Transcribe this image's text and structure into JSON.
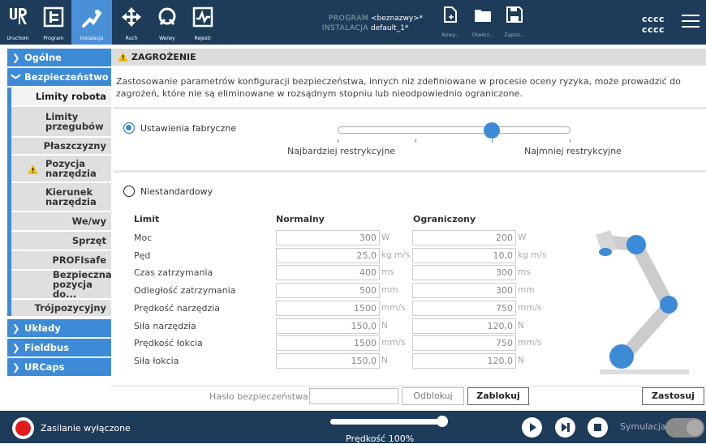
{
  "topbar": {
    "buttons": [
      {
        "label": "Uruchom",
        "icon": "ur-logo-icon"
      },
      {
        "label": "Program",
        "icon": "program-icon"
      },
      {
        "label": "Instalacja",
        "icon": "installation-icon",
        "active": true
      },
      {
        "label": "Ruch",
        "icon": "move-icon"
      },
      {
        "label": "We/wy",
        "icon": "io-icon"
      },
      {
        "label": "Rejestr",
        "icon": "log-icon"
      }
    ],
    "program_key": "PROGRAM",
    "program_value": "<beznazwy>*",
    "install_key": "INSTALACJA",
    "install_value": "default_1*",
    "file_buttons": [
      {
        "label": "Nowy...",
        "icon": "new-file-icon"
      },
      {
        "label": "Otwórz...",
        "icon": "open-folder-icon"
      },
      {
        "label": "Zapisz...",
        "icon": "save-icon"
      }
    ],
    "user_line1": "cccc",
    "user_line2": "cccc"
  },
  "sidebar": {
    "items": [
      {
        "label": "Ogólne",
        "level": 0
      },
      {
        "label": "Bezpieczeństwo",
        "level": 0,
        "expanded": true
      },
      {
        "label": "Limity robota",
        "level": 1,
        "selected": true
      },
      {
        "label": "Limity przegubów",
        "level": 1
      },
      {
        "label": "Płaszczyzny",
        "level": 1
      },
      {
        "label": "Pozycja narzędzia",
        "level": 1,
        "warning": true
      },
      {
        "label": "Kierunek narzędzia",
        "level": 1
      },
      {
        "label": "We/wy",
        "level": 1
      },
      {
        "label": "Sprzęt",
        "level": 1
      },
      {
        "label": "PROFIsafe",
        "level": 1
      },
      {
        "label": "Bezpieczna pozycja do...",
        "level": 1
      },
      {
        "label": "Trójpozycyjny",
        "level": 1
      },
      {
        "label": "Układy",
        "level": 0
      },
      {
        "label": "Fieldbus",
        "level": 0
      },
      {
        "label": "URCaps",
        "level": 0
      }
    ]
  },
  "main": {
    "header": "ZAGROŻENIE",
    "warning_text": "Zastosowanie parametrów konfiguracji bezpieczeństwa, innych niż zdefiniowane w procesie oceny ryzyka, może prowadzić do zagrożeń, które nie są eliminowane w rozsądnym stopniu lub nieodpowiednio ograniczone.",
    "factory_label": "Ustawienia fabryczne",
    "slider_left": "Najbardziej restrykcyjne",
    "slider_right": "Najmniej restrykcyjne",
    "slider_level": 0.66,
    "custom_label": "Niestandardowy",
    "table": {
      "col_limit": "Limit",
      "col_normal": "Normalny",
      "col_reduced": "Ograniczony",
      "rows": [
        {
          "name": "Moc",
          "normal": "300",
          "reduced": "200",
          "unit": "W"
        },
        {
          "name": "Pęd",
          "normal": "25,0",
          "reduced": "10,0",
          "unit": "kg m/s"
        },
        {
          "name": "Czas zatrzymania",
          "normal": "400",
          "reduced": "300",
          "unit": "ms"
        },
        {
          "name": "Odległość zatrzymania",
          "normal": "500",
          "reduced": "300",
          "unit": "mm"
        },
        {
          "name": "Prędkość narzędzia",
          "normal": "1500",
          "reduced": "750",
          "unit": "mm/s"
        },
        {
          "name": "Siła narzędzia",
          "normal": "150,0",
          "reduced": "120,0",
          "unit": "N"
        },
        {
          "name": "Prędkość łokcia",
          "normal": "1500",
          "reduced": "750",
          "unit": "mm/s"
        },
        {
          "name": "Siła łokcia",
          "normal": "150,0",
          "reduced": "120,0",
          "unit": "N"
        }
      ]
    },
    "password_label": "Hasło bezpieczeństwa",
    "unlock_label": "Odblokuj",
    "lock_label": "Zablokuj",
    "apply_label": "Zastosuj"
  },
  "footer": {
    "power_label": "Zasilanie wyłączone",
    "speed_label": "Prędkość 100%",
    "speed_value": 100,
    "sim_label": "Symulacja",
    "controls": [
      "play-icon",
      "step-icon",
      "stop-icon"
    ]
  },
  "colors": {
    "topbar": "#1e3c5a",
    "accent": "#3d8ad6",
    "power": "#e31b1b"
  }
}
